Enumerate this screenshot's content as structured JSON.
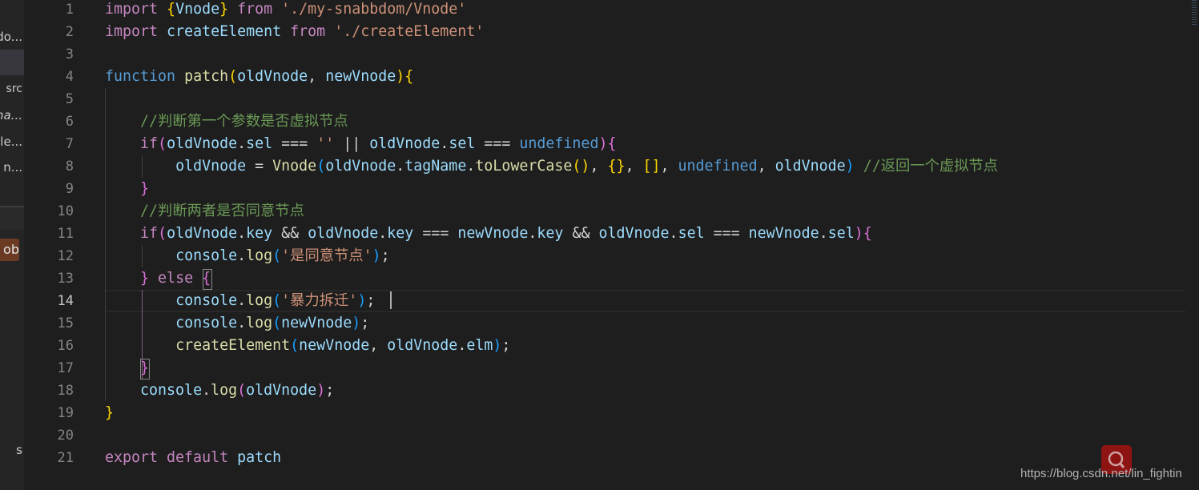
{
  "sidebar": {
    "items": [
      "do...",
      "src",
      "na...",
      "le...",
      "n..."
    ],
    "badge": "ob",
    "bottom_text": "s"
  },
  "editor": {
    "active_line": 14,
    "line_numbers": [
      "1",
      "2",
      "3",
      "4",
      "5",
      "6",
      "7",
      "8",
      "9",
      "10",
      "11",
      "12",
      "13",
      "14",
      "15",
      "16",
      "17",
      "18",
      "19",
      "20",
      "21"
    ],
    "lines": [
      [
        [
          "k",
          "import "
        ],
        [
          "b1",
          "{"
        ],
        [
          "v",
          "Vnode"
        ],
        [
          "b1",
          "}"
        ],
        [
          "k",
          " from "
        ],
        [
          "str",
          "'./my-snabbdom/Vnode'"
        ]
      ],
      [
        [
          "k",
          "import "
        ],
        [
          "v",
          "createElement"
        ],
        [
          "k",
          " from "
        ],
        [
          "str",
          "'./createElement'"
        ]
      ],
      [],
      [
        [
          "s",
          "function "
        ],
        [
          "f",
          "patch"
        ],
        [
          "b1",
          "("
        ],
        [
          "v",
          "oldVnode"
        ],
        [
          "p",
          ", "
        ],
        [
          "v",
          "newVnode"
        ],
        [
          "b1",
          ")"
        ],
        [
          "b1",
          "{"
        ]
      ],
      [],
      [
        [
          "p",
          "    "
        ],
        [
          "c",
          "//判断第一个参数是否虚拟节点"
        ]
      ],
      [
        [
          "p",
          "    "
        ],
        [
          "k",
          "if"
        ],
        [
          "b2",
          "("
        ],
        [
          "v",
          "oldVnode"
        ],
        [
          "p",
          "."
        ],
        [
          "v",
          "sel"
        ],
        [
          "p",
          " === "
        ],
        [
          "str",
          "''"
        ],
        [
          "p",
          " || "
        ],
        [
          "v",
          "oldVnode"
        ],
        [
          "p",
          "."
        ],
        [
          "v",
          "sel"
        ],
        [
          "p",
          " === "
        ],
        [
          "s",
          "undefined"
        ],
        [
          "b2",
          ")"
        ],
        [
          "b2",
          "{"
        ]
      ],
      [
        [
          "p",
          "        "
        ],
        [
          "v",
          "oldVnode"
        ],
        [
          "p",
          " = "
        ],
        [
          "f",
          "Vnode"
        ],
        [
          "b3",
          "("
        ],
        [
          "v",
          "oldVnode"
        ],
        [
          "p",
          "."
        ],
        [
          "v",
          "tagName"
        ],
        [
          "p",
          "."
        ],
        [
          "f",
          "toLowerCase"
        ],
        [
          "b1",
          "()"
        ],
        [
          "p",
          ", "
        ],
        [
          "b1",
          "{}"
        ],
        [
          "p",
          ", "
        ],
        [
          "b1",
          "[]"
        ],
        [
          "p",
          ", "
        ],
        [
          "s",
          "undefined"
        ],
        [
          "p",
          ", "
        ],
        [
          "v",
          "oldVnode"
        ],
        [
          "b3",
          ")"
        ],
        [
          "p",
          " "
        ],
        [
          "c",
          "//返回一个虚拟节点"
        ]
      ],
      [
        [
          "p",
          "    "
        ],
        [
          "b2",
          "}"
        ]
      ],
      [
        [
          "p",
          "    "
        ],
        [
          "c",
          "//判断两者是否同意节点"
        ]
      ],
      [
        [
          "p",
          "    "
        ],
        [
          "k",
          "if"
        ],
        [
          "b2",
          "("
        ],
        [
          "v",
          "oldVnode"
        ],
        [
          "p",
          "."
        ],
        [
          "v",
          "key"
        ],
        [
          "p",
          " && "
        ],
        [
          "v",
          "oldVnode"
        ],
        [
          "p",
          "."
        ],
        [
          "v",
          "key"
        ],
        [
          "p",
          " === "
        ],
        [
          "v",
          "newVnode"
        ],
        [
          "p",
          "."
        ],
        [
          "v",
          "key"
        ],
        [
          "p",
          " && "
        ],
        [
          "v",
          "oldVnode"
        ],
        [
          "p",
          "."
        ],
        [
          "v",
          "sel"
        ],
        [
          "p",
          " === "
        ],
        [
          "v",
          "newVnode"
        ],
        [
          "p",
          "."
        ],
        [
          "v",
          "sel"
        ],
        [
          "b2",
          ")"
        ],
        [
          "b2",
          "{"
        ]
      ],
      [
        [
          "p",
          "        "
        ],
        [
          "v",
          "console"
        ],
        [
          "p",
          "."
        ],
        [
          "f",
          "log"
        ],
        [
          "b3",
          "("
        ],
        [
          "str",
          "'是同意节点'"
        ],
        [
          "b3",
          ")"
        ],
        [
          "p",
          ";"
        ]
      ],
      [
        [
          "p",
          "    "
        ],
        [
          "b2",
          "}"
        ],
        [
          "k",
          " else "
        ],
        [
          "b2",
          "{"
        ]
      ],
      [
        [
          "p",
          "        "
        ],
        [
          "v",
          "console"
        ],
        [
          "p",
          "."
        ],
        [
          "f",
          "log"
        ],
        [
          "b3",
          "("
        ],
        [
          "str",
          "'暴力拆迁'"
        ],
        [
          "b3",
          ")"
        ],
        [
          "p",
          ";"
        ]
      ],
      [
        [
          "p",
          "        "
        ],
        [
          "v",
          "console"
        ],
        [
          "p",
          "."
        ],
        [
          "f",
          "log"
        ],
        [
          "b3",
          "("
        ],
        [
          "v",
          "newVnode"
        ],
        [
          "b3",
          ")"
        ],
        [
          "p",
          ";"
        ]
      ],
      [
        [
          "p",
          "        "
        ],
        [
          "f",
          "createElement"
        ],
        [
          "b3",
          "("
        ],
        [
          "v",
          "newVnode"
        ],
        [
          "p",
          ", "
        ],
        [
          "v",
          "oldVnode"
        ],
        [
          "p",
          "."
        ],
        [
          "v",
          "elm"
        ],
        [
          "b3",
          ")"
        ],
        [
          "p",
          ";"
        ]
      ],
      [
        [
          "p",
          "    "
        ],
        [
          "b2",
          "}"
        ]
      ],
      [
        [
          "p",
          "    "
        ],
        [
          "v",
          "console"
        ],
        [
          "p",
          "."
        ],
        [
          "f",
          "log"
        ],
        [
          "b2",
          "("
        ],
        [
          "v",
          "oldVnode"
        ],
        [
          "b2",
          ")"
        ],
        [
          "p",
          ";"
        ]
      ],
      [
        [
          "b1",
          "}"
        ]
      ],
      [],
      [
        [
          "k",
          "export default "
        ],
        [
          "v",
          "patch"
        ]
      ]
    ]
  },
  "watermark": {
    "text": "https://blog.csdn.net/lin_fightin",
    "icon": "search-icon",
    "color": "#8e1313"
  },
  "colors": {
    "background": "#1e1e1e",
    "keyword": "#c586c0",
    "storage": "#569cd6",
    "variable": "#9cdcfe",
    "function": "#dcdcaa",
    "string": "#ce9178",
    "comment": "#6a9955"
  }
}
